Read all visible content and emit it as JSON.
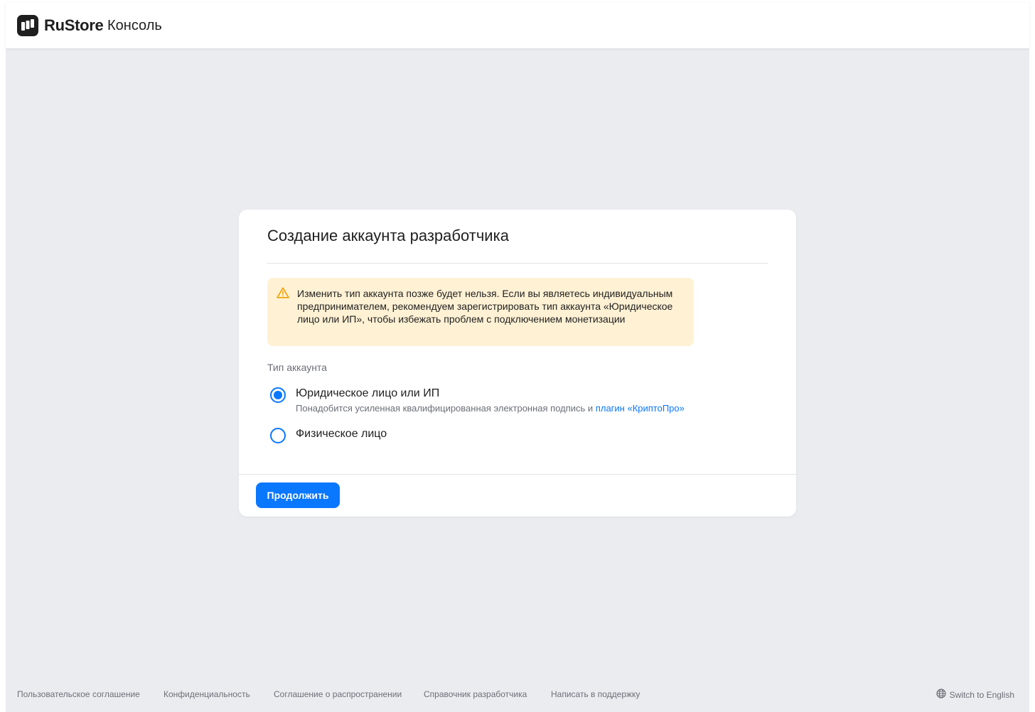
{
  "header": {
    "brand": "RuStore",
    "section": "Консоль"
  },
  "card": {
    "title": "Создание аккаунта разработчика",
    "warning": "Изменить тип аккаунта позже будет нельзя. Если вы являетесь индивидуальным предпринимателем, рекомендуем зарегистрировать тип аккаунта «Юридическое лицо или ИП», чтобы избежать проблем с подключением монетизации",
    "field_label": "Тип аккаунта",
    "options": [
      {
        "label": "Юридическое лицо или ИП",
        "hint": "Понадобится усиленная квалифицированная электронная подпись и",
        "hint_link": "плагин «КриптоПро»",
        "selected": true
      },
      {
        "label": "Физическое лицо",
        "selected": false
      }
    ],
    "continue_label": "Продолжить"
  },
  "footer": {
    "links": [
      "Пользовательское соглашение",
      "Конфиденциальность",
      "Соглашение о распространении",
      "Справочник разработчика",
      "Написать в поддержку"
    ],
    "language_switch": "Switch to English"
  },
  "colors": {
    "accent": "#0a77ff",
    "background": "#ebecf0",
    "warning_bg": "#fff1d4",
    "warning_icon": "#f0a100"
  },
  "icons": {
    "logo": "rustore-logo-icon",
    "warning": "warning-triangle-icon",
    "language": "globe-icon"
  }
}
